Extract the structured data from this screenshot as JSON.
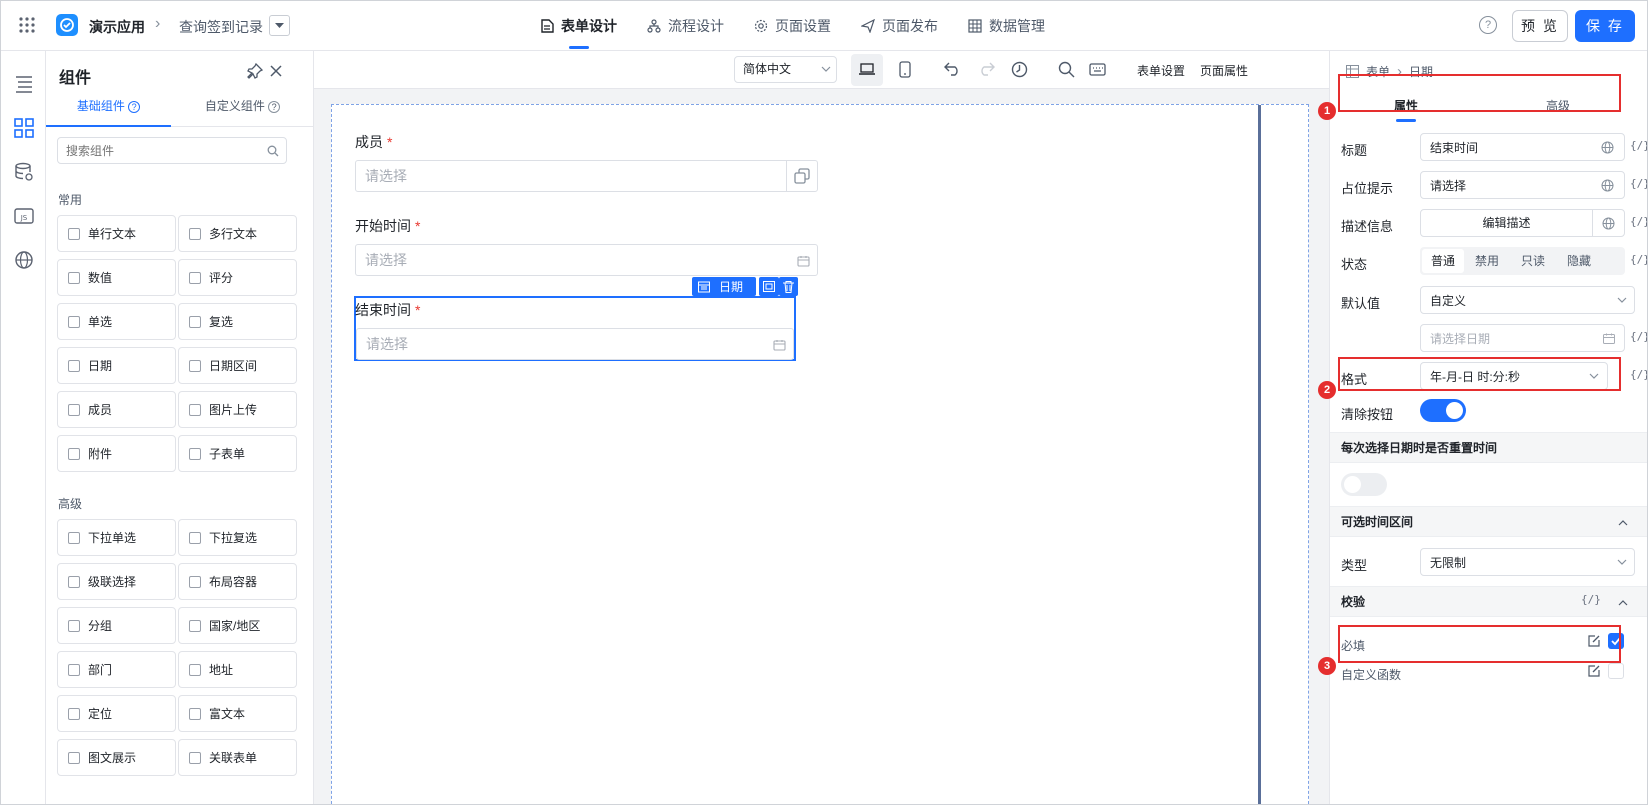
{
  "topbar": {
    "app_name": "演示应用",
    "page_name": "查询签到记录",
    "tabs": [
      {
        "label": "表单设计",
        "active": true
      },
      {
        "label": "流程设计",
        "active": false
      },
      {
        "label": "页面设置",
        "active": false
      },
      {
        "label": "页面发布",
        "active": false
      },
      {
        "label": "数据管理",
        "active": false
      }
    ],
    "preview_label": "预 览",
    "save_label": "保 存"
  },
  "components_panel": {
    "title": "组件",
    "tabs": [
      {
        "label": "基础组件",
        "active": true
      },
      {
        "label": "自定义组件",
        "active": false
      }
    ],
    "search_placeholder": "搜索组件",
    "common_label": "常用",
    "common_items": [
      "单行文本",
      "多行文本",
      "数值",
      "评分",
      "单选",
      "复选",
      "日期",
      "日期区间",
      "成员",
      "图片上传",
      "附件",
      "子表单"
    ],
    "advanced_label": "高级",
    "advanced_items": [
      "下拉单选",
      "下拉复选",
      "级联选择",
      "布局容器",
      "分组",
      "国家/地区",
      "部门",
      "地址",
      "定位",
      "富文本",
      "图文展示",
      "关联表单"
    ]
  },
  "toolbar": {
    "language": "简体中文",
    "form_settings": "表单设置",
    "page_props": "页面属性"
  },
  "canvas": {
    "fields": [
      {
        "label": "成员",
        "placeholder": "请选择"
      },
      {
        "label": "开始时间",
        "placeholder": "请选择"
      },
      {
        "label": "结束时间",
        "placeholder": "请选择"
      }
    ],
    "selected_tag": "日期"
  },
  "props": {
    "breadcrumb": [
      "表单",
      "日期"
    ],
    "tabs": [
      {
        "label": "属性",
        "active": true
      },
      {
        "label": "高级",
        "active": false
      }
    ],
    "title_label": "标题",
    "title_value": "结束时间",
    "placeholder_label": "占位提示",
    "placeholder_value": "请选择",
    "desc_label": "描述信息",
    "desc_button": "编辑描述",
    "state_label": "状态",
    "state_options": [
      "普通",
      "禁用",
      "只读",
      "隐藏"
    ],
    "default_label": "默认值",
    "default_value": "自定义",
    "default_date_placeholder": "请选择日期",
    "format_label": "格式",
    "format_value": "年-月-日 时:分:秒",
    "clear_label": "清除按钮",
    "clear_on": true,
    "reset_label": "每次选择日期时是否重置时间",
    "reset_on": false,
    "range_section": "可选时间区间",
    "type_label": "类型",
    "type_value": "无限制",
    "validate_section": "校验",
    "required_label": "必填",
    "required_checked": true,
    "custom_fn_label": "自定义函数",
    "custom_fn_checked": false,
    "fx": "{/}",
    "markers": [
      "1",
      "2",
      "3"
    ]
  },
  "colors": {
    "accent": "#1e6fff",
    "annotation": "#e52e2e"
  }
}
